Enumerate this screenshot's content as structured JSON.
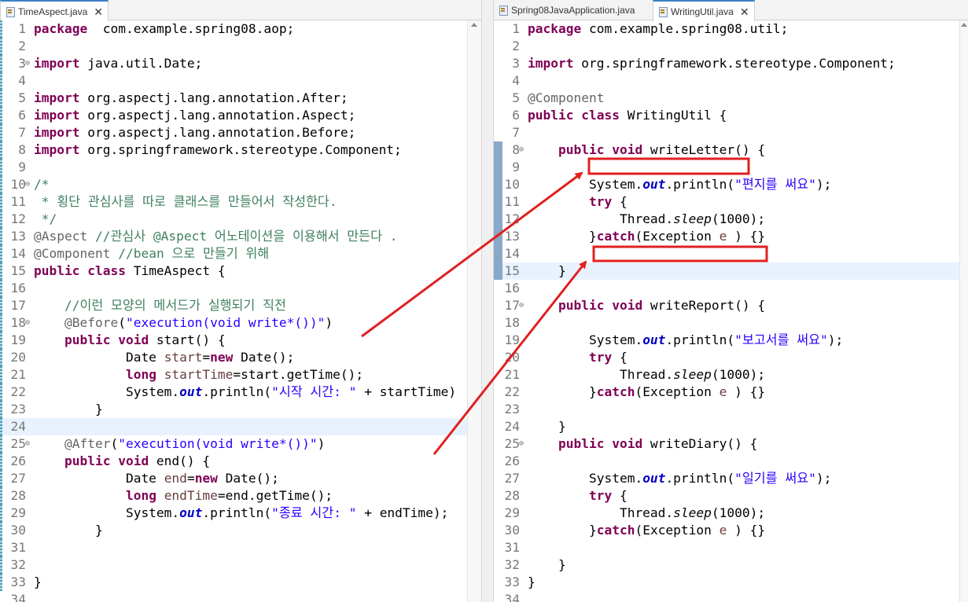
{
  "left": {
    "tabs": [
      {
        "label": "TimeAspect.java",
        "closable": true
      }
    ],
    "active_tab": 0,
    "lines": [
      {
        "n": "1",
        "fold": "",
        "mark": true,
        "segs": [
          [
            "kw",
            "package"
          ],
          [
            "",
            "  com.example.spring08.aop;"
          ]
        ]
      },
      {
        "n": "2",
        "fold": "",
        "mark": true,
        "segs": []
      },
      {
        "n": "3",
        "fold": "⊖",
        "mark": true,
        "segs": [
          [
            "kw",
            "import"
          ],
          [
            "",
            " java.util.Date;"
          ]
        ]
      },
      {
        "n": "4",
        "fold": "",
        "mark": true,
        "segs": []
      },
      {
        "n": "5",
        "fold": "",
        "mark": true,
        "segs": [
          [
            "kw",
            "import"
          ],
          [
            "",
            " org.aspectj.lang.annotation.After;"
          ]
        ]
      },
      {
        "n": "6",
        "fold": "",
        "mark": true,
        "segs": [
          [
            "kw",
            "import"
          ],
          [
            "",
            " org.aspectj.lang.annotation.Aspect;"
          ]
        ]
      },
      {
        "n": "7",
        "fold": "",
        "mark": true,
        "segs": [
          [
            "kw",
            "import"
          ],
          [
            "",
            " org.aspectj.lang.annotation.Before;"
          ]
        ]
      },
      {
        "n": "8",
        "fold": "",
        "mark": true,
        "segs": [
          [
            "kw",
            "import"
          ],
          [
            "",
            " org.springframework.stereotype.Component;"
          ]
        ]
      },
      {
        "n": "9",
        "fold": "",
        "mark": true,
        "segs": []
      },
      {
        "n": "10",
        "fold": "⊖",
        "mark": true,
        "segs": [
          [
            "cm",
            "/*"
          ]
        ]
      },
      {
        "n": "11",
        "fold": "",
        "mark": true,
        "segs": [
          [
            "cm",
            " * 횡단 관심사를 따로 클래스를 만들어서 작성한다."
          ]
        ]
      },
      {
        "n": "12",
        "fold": "",
        "mark": true,
        "segs": [
          [
            "cm",
            " */"
          ]
        ]
      },
      {
        "n": "13",
        "fold": "",
        "mark": true,
        "segs": [
          [
            "an",
            "@Aspect"
          ],
          [
            "",
            " "
          ],
          [
            "cm",
            "//관심사 @Aspect 어노테이션을 이용해서 만든다 ."
          ]
        ]
      },
      {
        "n": "14",
        "fold": "",
        "mark": true,
        "segs": [
          [
            "an",
            "@Component"
          ],
          [
            "",
            " "
          ],
          [
            "cm",
            "//bean 으로 만들기 위해"
          ]
        ]
      },
      {
        "n": "15",
        "fold": "",
        "mark": true,
        "segs": [
          [
            "kw",
            "public class"
          ],
          [
            "",
            " TimeAspect {"
          ]
        ]
      },
      {
        "n": "16",
        "fold": "",
        "mark": true,
        "segs": []
      },
      {
        "n": "17",
        "fold": "",
        "mark": true,
        "segs": [
          [
            "",
            "    "
          ],
          [
            "cm",
            "//이런 모양의 메서드가 실행되기 직전"
          ]
        ]
      },
      {
        "n": "18",
        "fold": "⊖",
        "mark": true,
        "segs": [
          [
            "",
            "    "
          ],
          [
            "an",
            "@Before"
          ],
          [
            "",
            "("
          ],
          [
            "st",
            "\"execution(void write*())\""
          ],
          [
            "",
            ")"
          ]
        ]
      },
      {
        "n": "19",
        "fold": "",
        "mark": true,
        "segs": [
          [
            "",
            "    "
          ],
          [
            "kw",
            "public void"
          ],
          [
            "",
            " start() {"
          ]
        ]
      },
      {
        "n": "20",
        "fold": "",
        "mark": true,
        "segs": [
          [
            "",
            "            Date "
          ],
          [
            "lv",
            "start"
          ],
          [
            "",
            "="
          ],
          [
            "kw",
            "new"
          ],
          [
            "",
            " Date();"
          ]
        ]
      },
      {
        "n": "21",
        "fold": "",
        "mark": true,
        "segs": [
          [
            "",
            "            "
          ],
          [
            "kw",
            "long"
          ],
          [
            "",
            " "
          ],
          [
            "lv",
            "startTime"
          ],
          [
            "",
            "=start.getTime();"
          ]
        ]
      },
      {
        "n": "22",
        "fold": "",
        "mark": true,
        "segs": [
          [
            "",
            "            System."
          ],
          [
            "fi",
            "out"
          ],
          [
            "",
            ".println("
          ],
          [
            "st",
            "\"시작 시간: \""
          ],
          [
            "",
            " + startTime)"
          ]
        ]
      },
      {
        "n": "23",
        "fold": "",
        "mark": true,
        "segs": [
          [
            "",
            "        }"
          ]
        ]
      },
      {
        "n": "24",
        "fold": "",
        "mark": true,
        "cur": true,
        "segs": []
      },
      {
        "n": "25",
        "fold": "⊖",
        "mark": true,
        "segs": [
          [
            "",
            "    "
          ],
          [
            "an",
            "@After"
          ],
          [
            "",
            "("
          ],
          [
            "st",
            "\"execution(void write*())\""
          ],
          [
            "",
            ")"
          ]
        ]
      },
      {
        "n": "26",
        "fold": "",
        "mark": true,
        "segs": [
          [
            "",
            "    "
          ],
          [
            "kw",
            "public void"
          ],
          [
            "",
            " end() {"
          ]
        ]
      },
      {
        "n": "27",
        "fold": "",
        "mark": true,
        "segs": [
          [
            "",
            "            Date "
          ],
          [
            "lv",
            "end"
          ],
          [
            "",
            "="
          ],
          [
            "kw",
            "new"
          ],
          [
            "",
            " Date();"
          ]
        ]
      },
      {
        "n": "28",
        "fold": "",
        "mark": true,
        "segs": [
          [
            "",
            "            "
          ],
          [
            "kw",
            "long"
          ],
          [
            "",
            " "
          ],
          [
            "lv",
            "endTime"
          ],
          [
            "",
            "=end.getTime();"
          ]
        ]
      },
      {
        "n": "29",
        "fold": "",
        "mark": true,
        "segs": [
          [
            "",
            "            System."
          ],
          [
            "fi",
            "out"
          ],
          [
            "",
            ".println("
          ],
          [
            "st",
            "\"종료 시간: \""
          ],
          [
            "",
            " + endTime);"
          ]
        ]
      },
      {
        "n": "30",
        "fold": "",
        "mark": true,
        "segs": [
          [
            "",
            "        }"
          ]
        ]
      },
      {
        "n": "31",
        "fold": "",
        "mark": true,
        "segs": []
      },
      {
        "n": "32",
        "fold": "",
        "mark": true,
        "segs": []
      },
      {
        "n": "33",
        "fold": "",
        "mark": true,
        "segs": [
          [
            "",
            "}"
          ]
        ]
      },
      {
        "n": "34",
        "fold": "",
        "mark": false,
        "segs": []
      }
    ]
  },
  "right": {
    "tabs": [
      {
        "label": "Spring08JavaApplication.java",
        "closable": false
      },
      {
        "label": "WritingUtil.java",
        "closable": true
      }
    ],
    "active_tab": 1,
    "lines": [
      {
        "n": "1",
        "fold": "",
        "mark": false,
        "segs": [
          [
            "kw",
            "package"
          ],
          [
            "",
            " com.example.spring08.util;"
          ]
        ]
      },
      {
        "n": "2",
        "fold": "",
        "mark": false,
        "segs": []
      },
      {
        "n": "3",
        "fold": "",
        "mark": false,
        "segs": [
          [
            "kw",
            "import"
          ],
          [
            "",
            " org.springframework.stereotype.Component;"
          ]
        ]
      },
      {
        "n": "4",
        "fold": "",
        "mark": false,
        "segs": []
      },
      {
        "n": "5",
        "fold": "",
        "mark": false,
        "segs": [
          [
            "an",
            "@Component"
          ]
        ]
      },
      {
        "n": "6",
        "fold": "",
        "mark": false,
        "segs": [
          [
            "kw",
            "public class"
          ],
          [
            "",
            " WritingUtil {"
          ]
        ]
      },
      {
        "n": "7",
        "fold": "",
        "mark": false,
        "segs": []
      },
      {
        "n": "8",
        "fold": "⊖",
        "mark": true,
        "segs": [
          [
            "",
            "    "
          ],
          [
            "kw",
            "public void"
          ],
          [
            "",
            " writeLetter() {"
          ]
        ]
      },
      {
        "n": "9",
        "fold": "",
        "mark": true,
        "segs": []
      },
      {
        "n": "10",
        "fold": "",
        "mark": true,
        "segs": [
          [
            "",
            "        System."
          ],
          [
            "fi",
            "out"
          ],
          [
            "",
            ".println("
          ],
          [
            "st",
            "\"편지를 써요\""
          ],
          [
            "",
            ");"
          ]
        ]
      },
      {
        "n": "11",
        "fold": "",
        "mark": true,
        "segs": [
          [
            "",
            "        "
          ],
          [
            "kw",
            "try"
          ],
          [
            "",
            " {"
          ]
        ]
      },
      {
        "n": "12",
        "fold": "",
        "mark": true,
        "segs": [
          [
            "",
            "            Thread."
          ],
          [
            "sm",
            "sleep"
          ],
          [
            "",
            "(1000);"
          ]
        ]
      },
      {
        "n": "13",
        "fold": "",
        "mark": true,
        "segs": [
          [
            "",
            "        }"
          ],
          [
            "kw",
            "catch"
          ],
          [
            "",
            "(Exception "
          ],
          [
            "lv",
            "e"
          ],
          [
            "",
            " ) {}"
          ]
        ]
      },
      {
        "n": "14",
        "fold": "",
        "mark": true,
        "segs": []
      },
      {
        "n": "15",
        "fold": "",
        "mark": true,
        "cur": true,
        "segs": [
          [
            "",
            "    }"
          ]
        ]
      },
      {
        "n": "16",
        "fold": "",
        "mark": false,
        "segs": []
      },
      {
        "n": "17",
        "fold": "⊖",
        "mark": false,
        "segs": [
          [
            "",
            "    "
          ],
          [
            "kw",
            "public void"
          ],
          [
            "",
            " writeReport() {"
          ]
        ]
      },
      {
        "n": "18",
        "fold": "",
        "mark": false,
        "segs": []
      },
      {
        "n": "19",
        "fold": "",
        "mark": false,
        "segs": [
          [
            "",
            "        System."
          ],
          [
            "fi",
            "out"
          ],
          [
            "",
            ".println("
          ],
          [
            "st",
            "\"보고서를 써요\""
          ],
          [
            "",
            ");"
          ]
        ]
      },
      {
        "n": "20",
        "fold": "",
        "mark": false,
        "segs": [
          [
            "",
            "        "
          ],
          [
            "kw",
            "try"
          ],
          [
            "",
            " {"
          ]
        ]
      },
      {
        "n": "21",
        "fold": "",
        "mark": false,
        "segs": [
          [
            "",
            "            Thread."
          ],
          [
            "sm",
            "sleep"
          ],
          [
            "",
            "(1000);"
          ]
        ]
      },
      {
        "n": "22",
        "fold": "",
        "mark": false,
        "segs": [
          [
            "",
            "        }"
          ],
          [
            "kw",
            "catch"
          ],
          [
            "",
            "(Exception "
          ],
          [
            "lv",
            "e"
          ],
          [
            "",
            " ) {}"
          ]
        ]
      },
      {
        "n": "23",
        "fold": "",
        "mark": false,
        "segs": []
      },
      {
        "n": "24",
        "fold": "",
        "mark": false,
        "segs": [
          [
            "",
            "    }"
          ]
        ]
      },
      {
        "n": "25",
        "fold": "⊖",
        "mark": false,
        "segs": [
          [
            "",
            "    "
          ],
          [
            "kw",
            "public void"
          ],
          [
            "",
            " writeDiary() {"
          ]
        ]
      },
      {
        "n": "26",
        "fold": "",
        "mark": false,
        "segs": []
      },
      {
        "n": "27",
        "fold": "",
        "mark": false,
        "segs": [
          [
            "",
            "        System."
          ],
          [
            "fi",
            "out"
          ],
          [
            "",
            ".println("
          ],
          [
            "st",
            "\"일기를 써요\""
          ],
          [
            "",
            ");"
          ]
        ]
      },
      {
        "n": "28",
        "fold": "",
        "mark": false,
        "segs": [
          [
            "",
            "        "
          ],
          [
            "kw",
            "try"
          ],
          [
            "",
            " {"
          ]
        ]
      },
      {
        "n": "29",
        "fold": "",
        "mark": false,
        "segs": [
          [
            "",
            "            Thread."
          ],
          [
            "sm",
            "sleep"
          ],
          [
            "",
            "(1000);"
          ]
        ]
      },
      {
        "n": "30",
        "fold": "",
        "mark": false,
        "segs": [
          [
            "",
            "        }"
          ],
          [
            "kw",
            "catch"
          ],
          [
            "",
            "(Exception "
          ],
          [
            "lv",
            "e"
          ],
          [
            "",
            " ) {}"
          ]
        ]
      },
      {
        "n": "31",
        "fold": "",
        "mark": false,
        "segs": []
      },
      {
        "n": "32",
        "fold": "",
        "mark": false,
        "segs": [
          [
            "",
            "    }"
          ]
        ]
      },
      {
        "n": "33",
        "fold": "",
        "mark": false,
        "segs": [
          [
            "",
            "}"
          ]
        ]
      },
      {
        "n": "34",
        "fold": "",
        "mark": false,
        "segs": []
      }
    ]
  },
  "colors": {
    "keyword": "#7f0055",
    "comment": "#3f7f5f",
    "string": "#2a00ff",
    "annotation": "#646464",
    "static_field": "#0000c0",
    "current_line": "#e8f2fe",
    "annotation_arrow": "#e02020"
  }
}
